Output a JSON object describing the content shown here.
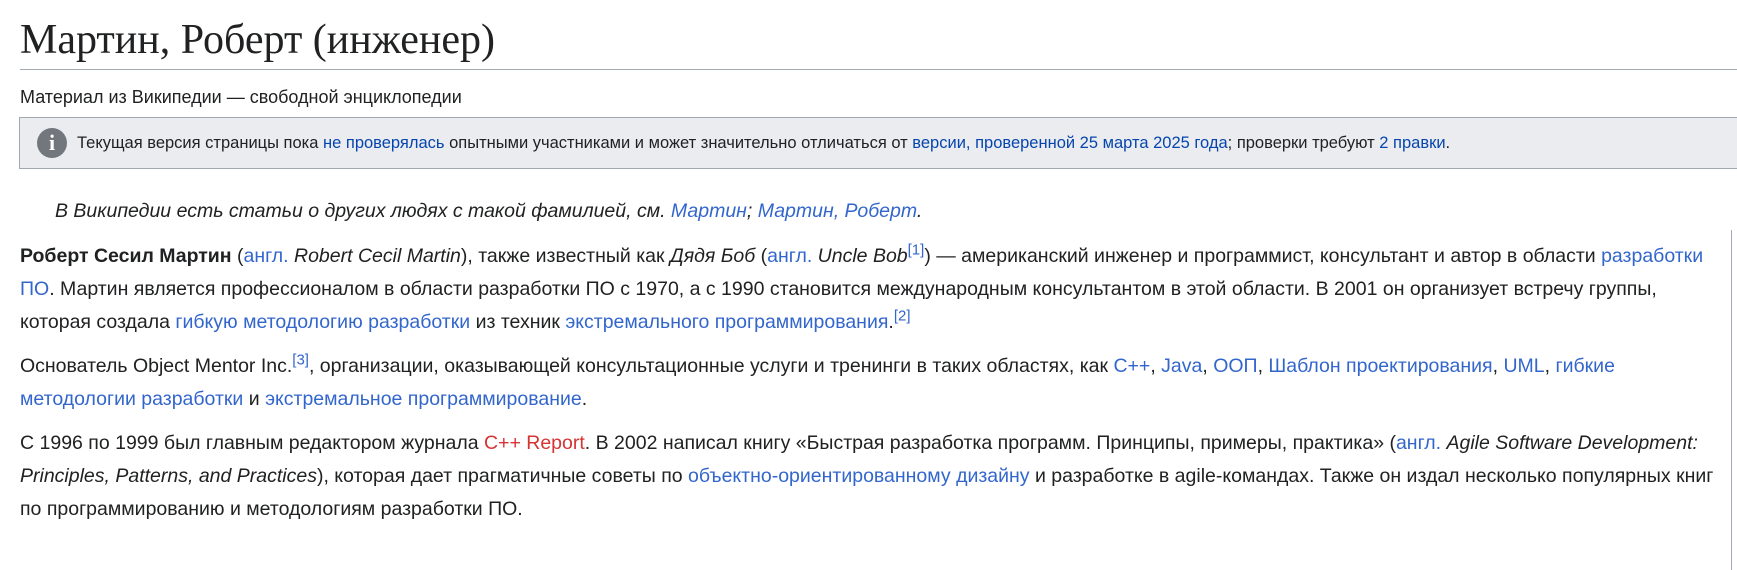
{
  "article": {
    "title": "Мартин, Роберт (инженер)",
    "tagline": "Материал из Википедии — свободной энциклопедии"
  },
  "notice": {
    "icon": "info-icon",
    "icon_glyph": "i",
    "text_1": "Текущая версия страницы пока ",
    "link_unchecked": "не проверялась",
    "text_2": " опытными участниками и может значительно отличаться от ",
    "link_version": "версии, проверенной 25 марта 2025 года",
    "text_3": "; проверки требуют ",
    "link_edits": "2 правки",
    "text_4": "."
  },
  "hatnote": {
    "text": "В Википедии есть статьи о других людях с такой фамилией, см. ",
    "link_1": "Мартин",
    "sep": "; ",
    "link_2": "Мартин, Роберт",
    "end": "."
  },
  "p1": {
    "bold_name": "Роберт Сесил Мартин",
    "t1": " (",
    "lang_1": "англ.",
    "t2": " ",
    "en_name": "Robert Cecil Martin",
    "t3": "), также известный как ",
    "nickname": "Дядя Боб",
    "t4": " (",
    "lang_2": "англ.",
    "t5": " ",
    "en_nickname": "Uncle Bob",
    "ref_1": "[1]",
    "t6": ") — американский инженер и программист, консультант и автор в области ",
    "link_dev": "разработки ПО",
    "t7": ". Мартин является профессионалом в области разработки ПО с 1970, а с 1990 становится международным консультантом в этой области. В 2001 он организует встречу группы, которая создала ",
    "link_agile": "гибкую методологию разработки",
    "t8": " из техник ",
    "link_xp": "экстремального программирования",
    "t9": ".",
    "ref_2": "[2]"
  },
  "p2": {
    "t1": "Основатель Object Mentor Inc.",
    "ref_3": "[3]",
    "t2": ", организации, оказывающей консультационные услуги и тренинги в таких областях, как ",
    "link_cpp": "C++",
    "c1": ", ",
    "link_java": "Java",
    "c2": ", ",
    "link_oop": "ООП",
    "c3": ", ",
    "link_patterns": "Шаблон проектирования",
    "c4": ", ",
    "link_uml": "UML",
    "c5": ", ",
    "link_agile_methods": "гибкие методологии разработки",
    "t3": " и ",
    "link_xp2": "экстремальное программирование",
    "t4": "."
  },
  "p3": {
    "t1": "С 1996 по 1999 был главным редактором журнала ",
    "redlink_report": "C++ Report",
    "t2": ". В 2002 написал книгу «Быстрая разработка программ. Принципы, примеры, практика» (",
    "lang_3": "англ.",
    "t3": " ",
    "en_book": "Agile Software Development: Principles, Patterns, and Practices",
    "t4": "), которая дает прагматичные советы по ",
    "link_ood": "объектно-ориентированному дизайну",
    "t5": " и разработке в agile-командах. Также он издал несколько популярных книг по программированию и методологиям разработки ПО."
  },
  "colors": {
    "link": "#3366cc",
    "redlink": "#d73333",
    "text": "#202122",
    "notice_bg": "#eaecf0",
    "border": "#a2a9b1"
  }
}
